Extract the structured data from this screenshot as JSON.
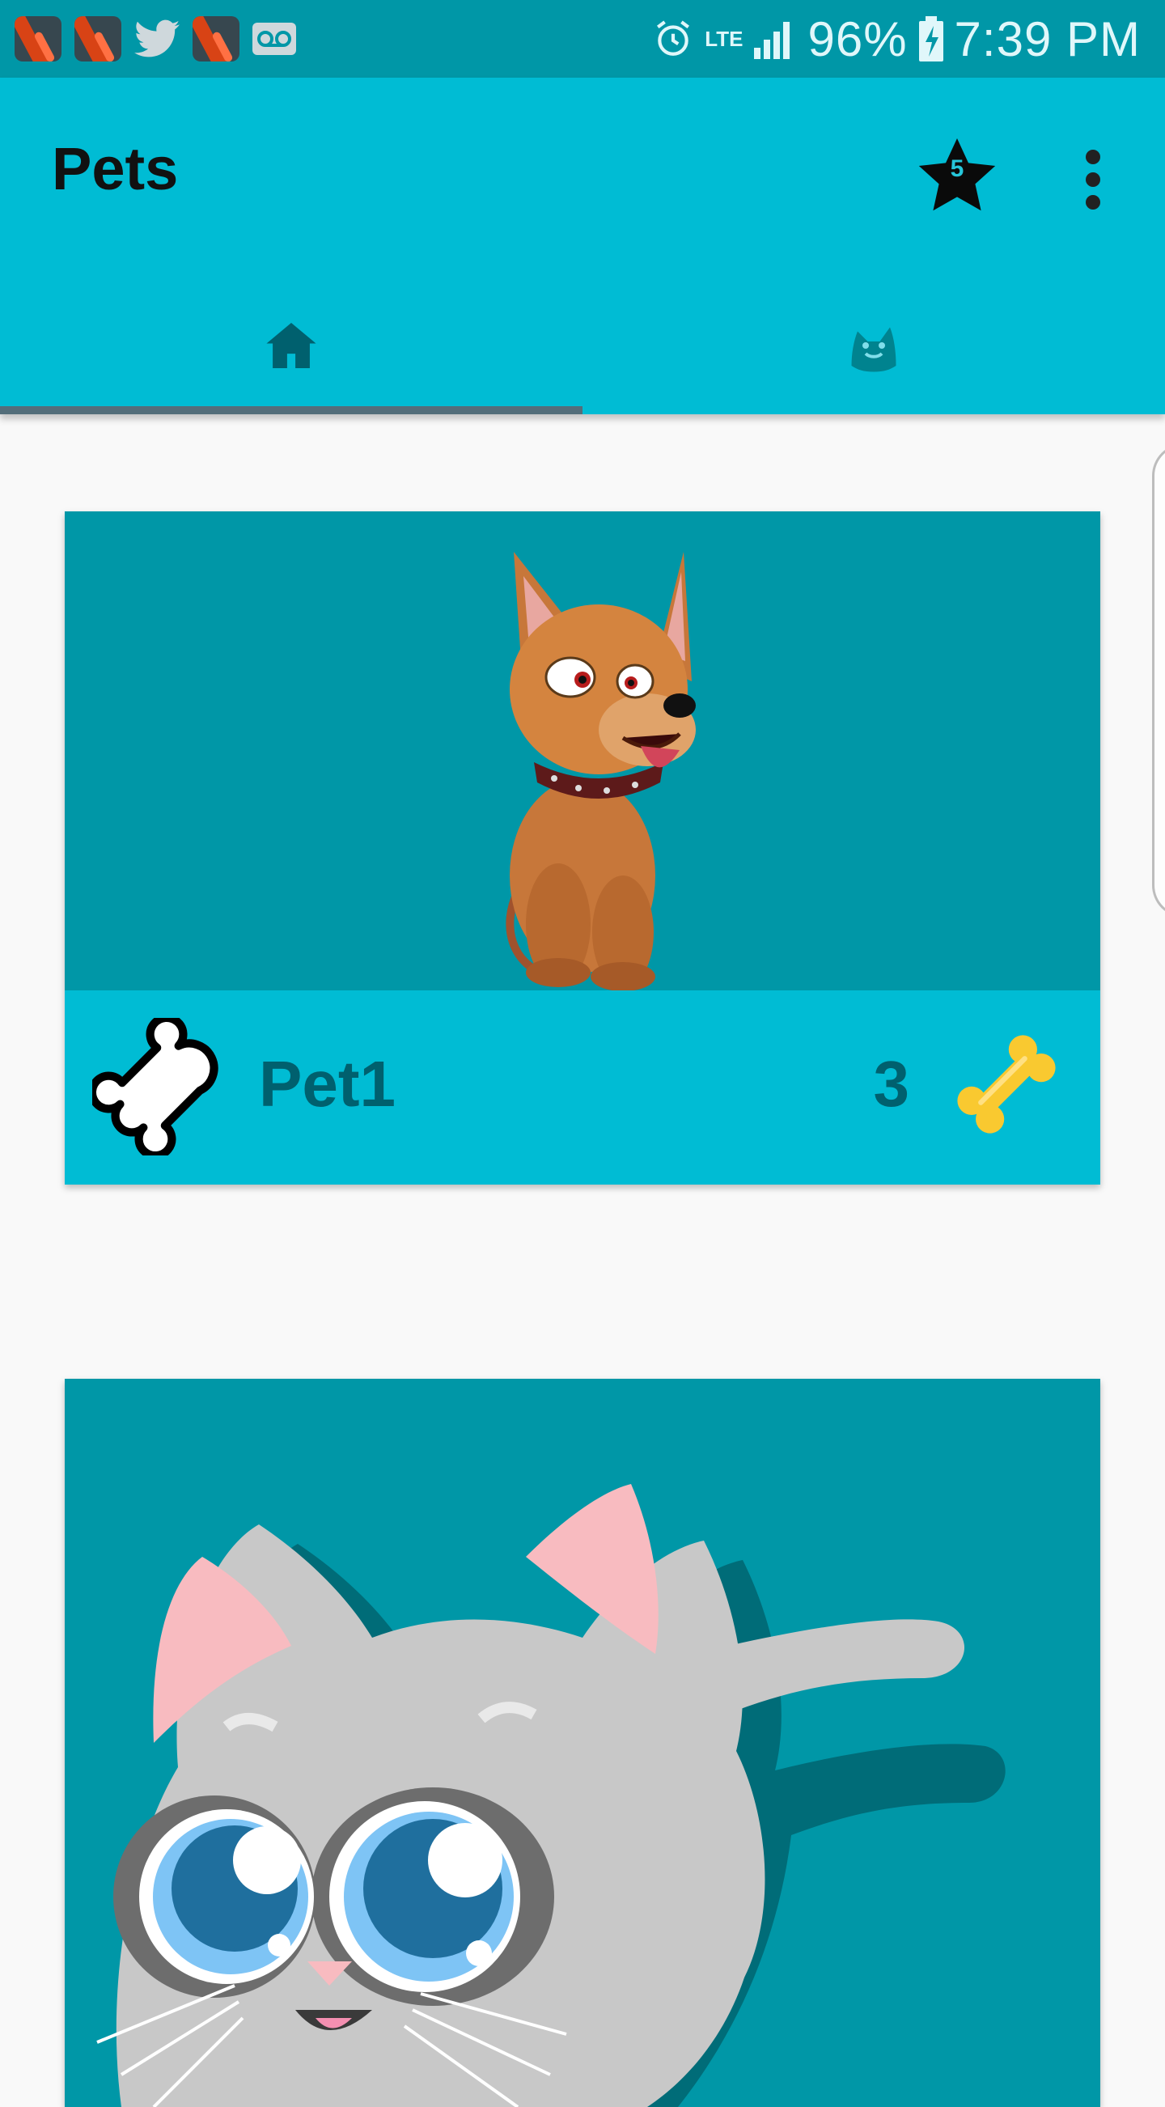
{
  "status_bar": {
    "notification_icons": [
      "app-notification-icon",
      "app-notification-icon",
      "twitter-icon",
      "app-notification-icon",
      "voicemail-icon"
    ],
    "network": "LTE",
    "battery": "96%",
    "time": "7:39 PM"
  },
  "app_bar": {
    "title": "Pets",
    "star_count": "5"
  },
  "tabs": [
    {
      "icon": "home-icon",
      "selected": true
    },
    {
      "icon": "pet-face-icon",
      "selected": false
    }
  ],
  "pets": [
    {
      "name": "Pet1",
      "count": "3",
      "image": "dog-illustration"
    },
    {
      "image": "cat-illustration"
    }
  ],
  "colors": {
    "status_bar": "#0097a7",
    "app_bar": "#00bcd4",
    "card_image_bg": "#0097a7",
    "card_footer_bg": "#00bcd4",
    "tab_indicator": "#546e7a",
    "bone_gold": "#f9c930"
  }
}
